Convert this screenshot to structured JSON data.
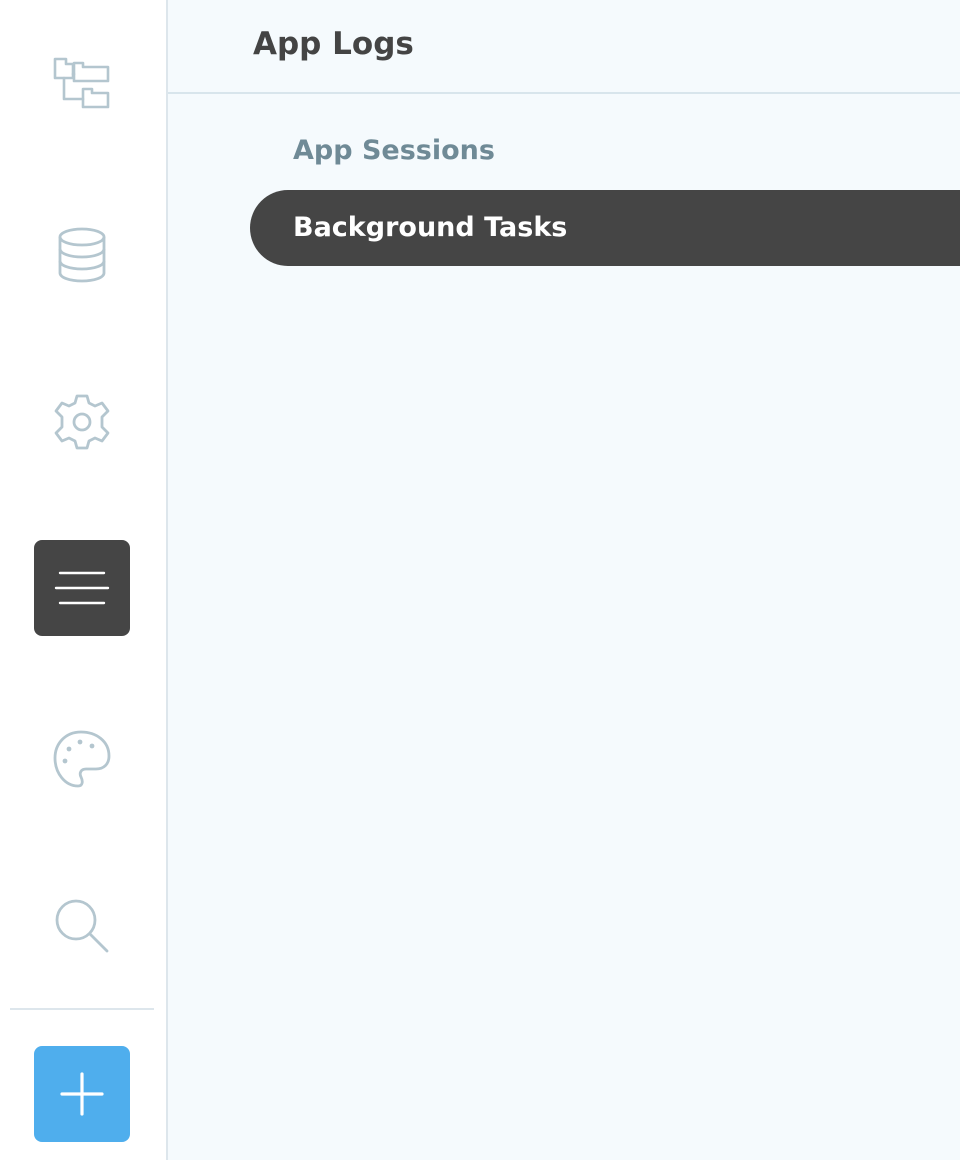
{
  "sidebar": {
    "items": [
      {
        "icon": "folder-tree-icon",
        "active": false
      },
      {
        "icon": "database-icon",
        "active": false
      },
      {
        "icon": "gear-icon",
        "active": false
      },
      {
        "icon": "hamburger-menu-icon",
        "active": true
      },
      {
        "icon": "palette-icon",
        "active": false
      },
      {
        "icon": "search-icon",
        "active": false
      }
    ],
    "add_button_icon": "plus-icon"
  },
  "header": {
    "title": "App Logs"
  },
  "log_list": {
    "items": [
      {
        "label": "App Sessions",
        "active": false
      },
      {
        "label": "Background Tasks",
        "active": true
      }
    ]
  },
  "colors": {
    "active_background": "#454545",
    "add_button_background": "#4faeed",
    "icon_stroke": "#b4c6cf",
    "main_background": "#f5fafd",
    "inactive_text": "#6f8a96",
    "title_text": "#444444"
  }
}
